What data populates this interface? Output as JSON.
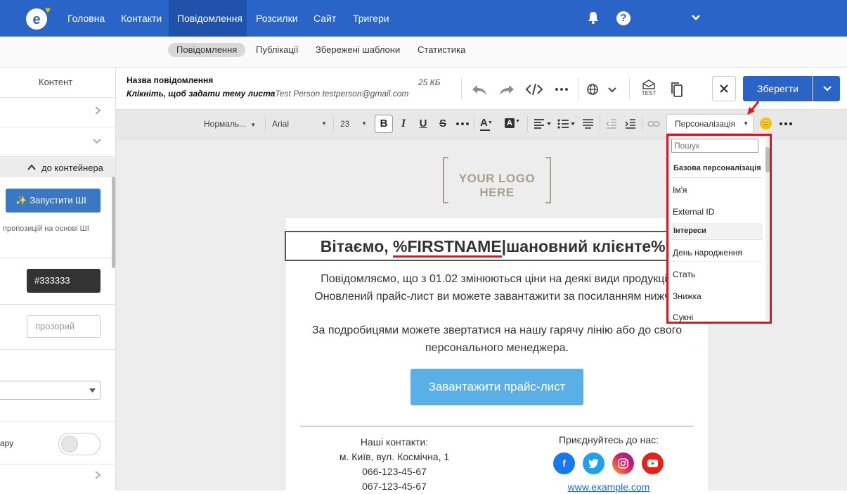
{
  "nav": {
    "items": [
      "Головна",
      "Контакти",
      "Повідомлення",
      "Розсилки",
      "Сайт",
      "Тригери"
    ],
    "active": "Повідомлення"
  },
  "subnav": {
    "items": [
      "Повідомлення",
      "Публікації",
      "Збережені шаблони",
      "Статистика"
    ]
  },
  "left": {
    "content_label": "Контент",
    "container_label": "до контейнера",
    "ai_button": "Запустити ШІ",
    "ai_hint": "пропозицій на основі ШІ",
    "color_value": "#333333",
    "transparent_value": "прозорий",
    "toggle_label": "ару"
  },
  "header": {
    "message_name": "Назва повідомлення",
    "subject_hint": "Клікніть, щоб задати тему листа",
    "sender": "Test Person testperson@gmail.com",
    "size": "25 КБ",
    "test_label": "TEST",
    "save_label": "Зберегти"
  },
  "format": {
    "style": "Нормаль...",
    "font": "Arial",
    "size": "23",
    "personalization": "Персоналізація"
  },
  "dropdown": {
    "search_placeholder": "Пошук",
    "group1": "Базова персоналізація",
    "item1": "Ім'я",
    "item2": "External ID",
    "group2": "Інтереси",
    "item3": "День народження",
    "item4": "Стать",
    "item5": "Знижка",
    "item6": "Сукні"
  },
  "email": {
    "logo": "YOUR LOGO HERE",
    "greeting_prefix": "Вітаємо, ",
    "greeting_var": "%FIRSTNAME",
    "greeting_suffix": "|шановний клієнте%!",
    "para1_line1": "Повідомляємо, що з 01.02 змінюються ціни на деякі види продукції.",
    "para1_line2": "Оновлений прайс-лист ви можете завантажити за посиланням нижче.",
    "para2_line1": "За подробицями можете звертатися на нашу гарячу лінію або до свого",
    "para2_line2": "персонального менеджера.",
    "button": "Завантажити прайс-лист",
    "contacts_title": "Наші контакти:",
    "address": "м. Київ, вул. Космічна, 1",
    "phone1": "066-123-45-67",
    "phone2": "067-123-45-67",
    "join_title": "Приєднуйтесь до нас:",
    "website": "www.example.com"
  },
  "colors": {
    "primary": "#2a64c6",
    "highlight": "#e0141e",
    "email_button": "#5ab0e6"
  }
}
